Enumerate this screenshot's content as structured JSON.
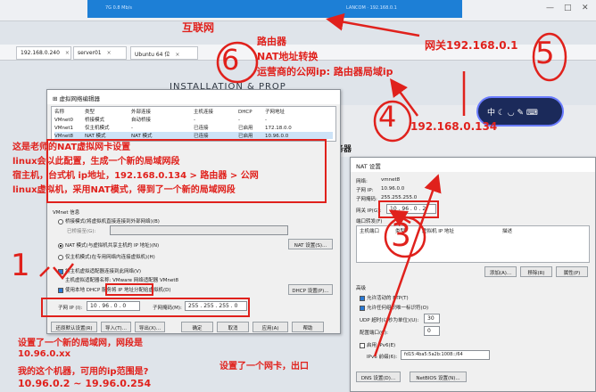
{
  "top": {
    "blue_left": "7G 0.8 Mb/s",
    "blue_right": "LANCOM · 192.168.0.1",
    "win_min": "—",
    "win_max": "□",
    "win_close": "✕"
  },
  "tabs": [
    {
      "label": "192.168.0.240"
    },
    {
      "label": "server01"
    },
    {
      "label": "Ubuntu 64 位"
    }
  ],
  "tab_close": "×",
  "bg_heading": "INSTALLATION & PROP",
  "services_label": "服务器",
  "vne": {
    "title": "虚拟网络编辑器",
    "headers": [
      "名称",
      "类型",
      "外部连接",
      "主机连接",
      "DHCP",
      "子网地址"
    ],
    "rows": [
      [
        "VMnet0",
        "桥接模式",
        "自动桥接",
        "-",
        "-",
        "-"
      ],
      [
        "VMnet1",
        "仅主机模式",
        "-",
        "已连接",
        "已启用",
        "172.18.0.0"
      ],
      [
        "VMnet8",
        "NAT 模式",
        "NAT 模式",
        "已连接",
        "已启用",
        "10.96.0.0"
      ]
    ],
    "vmnet_info": "VMnet 信息",
    "bridge_opt": "桥接模式(将虚拟机直接连接到外部网络)(B)",
    "bridged_to": "已桥接至(G):",
    "nat_opt": "NAT 模式(与虚拟机共享主机的 IP 地址)(N)",
    "nat_settings_btn": "NAT 设置(S)...",
    "host_only_opt": "仅主机模式(在专用网络内连接虚拟机)(H)",
    "connect_adapter": "将主机虚拟适配器连接到此网络(V)",
    "adapter_name": "主机虚拟适配器名称: VMware 网络适配器 VMnet8",
    "use_dhcp": "使用本地 DHCP 服务将 IP 地址分配给虚拟机(D)",
    "dhcp_settings_btn": "DHCP 设置(P)...",
    "subnet_ip_label": "子网 IP (I):",
    "subnet_ip": [
      "10",
      "96",
      "0",
      "0"
    ],
    "mask_label": "子网掩码(M):",
    "mask": [
      "255",
      "255",
      "255",
      "0"
    ],
    "buttons": [
      "还原默认设置(R)",
      "导入(T)...",
      "导出(X)...",
      "确定",
      "取消",
      "应用(A)",
      "帮助"
    ]
  },
  "nat": {
    "title": "NAT 设置",
    "network_label": "网络:",
    "network": "vmnet8",
    "subnet_ip_label": "子网 IP:",
    "subnet_ip": "10.96.0.0",
    "mask_label": "子网掩码:",
    "mask": "255.255.255.0",
    "gateway_label": "网关 IP(G):",
    "gateway": [
      "10",
      "96",
      "0",
      "2"
    ],
    "port_fwd": "端口转发(F)",
    "pf_headers": [
      "主机端口",
      "类型",
      "虚拟机 IP 地址",
      "描述"
    ],
    "pf_buttons": [
      "添加(A)...",
      "移除(R)",
      "属性(P)"
    ],
    "advanced": "高级",
    "allow_ftp": "允许活动的 FTP(T)",
    "allow_oui": "允许任何组织唯一标识符(O)",
    "udp_label": "UDP 超时(以秒为单位)(U):",
    "udp_val": "30",
    "cfg_port_label": "配置端口(C):",
    "cfg_port_val": "0",
    "ipv6_label": "启用 IPv6(E)",
    "ipv6_prefix_label": "IPv6 前缀(6):",
    "ipv6_prefix": "fd15:4ba5:5a2b:1008::/64",
    "dns_btn": "DNS 设置(D)...",
    "netbios_btn": "NetBIOS 设置(N)..."
  },
  "ime": {
    "text": "中 ☾ ◡ ✎ ⌨"
  },
  "notes": {
    "internet": "互联网",
    "router": "路由器",
    "nat_translate": "NAT地址转换",
    "isp_ip": "运营商的公网ip: 路由器局域ip",
    "gateway": "网关192.168.0.1",
    "host_ip": "192.168.0.134",
    "teacher_lines": [
      "这是老师的NAT虚拟网卡设置",
      "linux会以此配置，生成一个新的局域网段",
      "宿主机，台式机 ip地址，192.168.0.134 > 路由器 > 公网",
      "linux虚拟机，采用NAT模式，得到了一个新的局域网段"
    ],
    "new_lan_lines": [
      "设置了一个新的局域网，网段是",
      "10.96.0.xx",
      "我的这个机器，可用的ip范围是?",
      "10.96.0.2 ~ 19.96.0.254"
    ],
    "nic_note": "设置了一个网卡，出口",
    "num1": "1",
    "num3": "3",
    "num4": "4",
    "num5": "5",
    "num6": "6"
  }
}
